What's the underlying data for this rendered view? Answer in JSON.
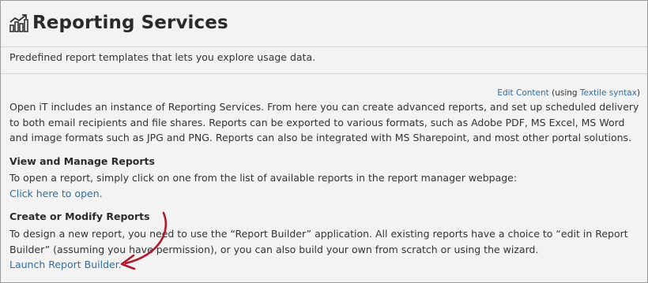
{
  "header": {
    "title": "Reporting Services",
    "icon": "chart-growth-icon"
  },
  "subtitle": "Predefined report templates that lets you explore usage data.",
  "edit": {
    "link": "Edit Content",
    "pre": "(using ",
    "syntax_link": "Textile syntax",
    "post": ")"
  },
  "intro": "Open iT includes an instance of Reporting Services. From here you can create advanced reports, and set up scheduled delivery to both email recipients and file shares. Reports can be exported to various formats, such as Adobe PDF, MS Excel, MS Word and image formats such as JPG and PNG. Reports can also be integrated with MS Sharepoint, and most other portal solutions.",
  "view_section": {
    "heading": "View and Manage Reports",
    "text": "To open a report, simply click on one from the list of available reports in the report manager webpage:",
    "link": "Click here to open."
  },
  "create_section": {
    "heading": "Create or Modify Reports",
    "text": "To design a new report, you need to use the “Report Builder” application. All existing reports have a choice to “edit in Report Builder” (assuming you have permission), or you can also build your own from scratch or using the wizard.",
    "link": "Launch Report Builder."
  },
  "colors": {
    "link": "#2f6ea6",
    "arrow": "#b0182a"
  }
}
